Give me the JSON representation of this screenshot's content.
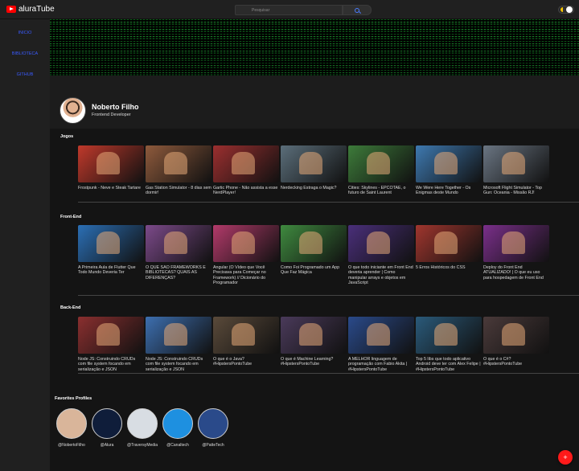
{
  "app": {
    "logo_text": "aluraTube"
  },
  "search": {
    "placeholder": "Pesquisar"
  },
  "sidebar": {
    "items": [
      {
        "label": "Inicio"
      },
      {
        "label": "Biblioteca"
      },
      {
        "label": "Github"
      }
    ]
  },
  "profile": {
    "name": "Noberto Filho",
    "role": "Frontend Developer"
  },
  "sections": [
    {
      "title": "Jogos",
      "videos": [
        {
          "title": "Frostpunk - Neve e Steak Tartare",
          "thumb_color": "#c0392b"
        },
        {
          "title": "Gas Station Simulator - 8 dias sem dormir!",
          "thumb_color": "#8e5a3c"
        },
        {
          "title": "Gartic Phone - Não assista a esse NerdPlayer!",
          "thumb_color": "#9b2f2f"
        },
        {
          "title": "Nerdecking Estraga o Magic?",
          "thumb_color": "#5b6e7a"
        },
        {
          "title": "Cities: Skylines - EPCOTAE, o futuro de Saint Laurent",
          "thumb_color": "#3d7b3a"
        },
        {
          "title": "We Were Here Together - Os Enigmas deste Mundo",
          "thumb_color": "#3e79b0"
        },
        {
          "title": "Microsoft Flight Simulator - Top Gun: Oceania - Missão RJ!",
          "thumb_color": "#6a7582"
        }
      ]
    },
    {
      "title": "Front-End",
      "videos": [
        {
          "title": "A Primeira Aula de Flutter Que Todo Mundo Deveria Ter",
          "thumb_color": "#2b6fb5"
        },
        {
          "title": "O QUE SÃO FRAMEWORKS E BIBLIOTECAS? QUAIS AS DIFERENÇAS?",
          "thumb_color": "#7c4a8a"
        },
        {
          "title": "Angular (O Vídeo que Você Precisava para Começar no Framework) // Dicionário do Programador",
          "thumb_color": "#b23a6a"
        },
        {
          "title": "Como Foi Programado um App Que Faz Mágica",
          "thumb_color": "#3f8a3f"
        },
        {
          "title": "O que todo iniciante em Front End deveria aprender | Como manipular arrays e objetos em JavaScript",
          "thumb_color": "#4a2f7a"
        },
        {
          "title": "5 Erros Históricos do CSS",
          "thumb_color": "#a0362e"
        },
        {
          "title": "Deploy do Front End ATUALIZADO! | O que eu uso para hospedagem de Front End",
          "thumb_color": "#7a2f8a"
        }
      ]
    },
    {
      "title": "Back-End",
      "videos": [
        {
          "title": "Node JS: Construindo CRUDs com file system focando em serialização e JSON",
          "thumb_color": "#8a2f2f"
        },
        {
          "title": "Node JS: Construindo CRUDs com file system focando em serialização e JSON",
          "thumb_color": "#3d6fb0"
        },
        {
          "title": "O que é o Java? #HipstersPontoTube",
          "thumb_color": "#5a4a3a"
        },
        {
          "title": "O que é Machine Learning? #HipstersPontoTube",
          "thumb_color": "#4a3a5a"
        },
        {
          "title": "A MELHOR linguagem de programação com Fabio Akita | #HipstersPontoTube",
          "thumb_color": "#2a4a8a"
        },
        {
          "title": "Top 5 libs que todo aplicativo Android deve ter com Alex Felipe | #HipstersPontoTube",
          "thumb_color": "#2a5a7a"
        },
        {
          "title": "O que é o C#? #HipstersPontoTube",
          "thumb_color": "#4a3a3a"
        }
      ]
    }
  ],
  "favorites": {
    "title": "Favorites Profiles",
    "profiles": [
      {
        "handle": "@NobertoFilho",
        "color": "#d9b59a",
        "icon": "person-photo"
      },
      {
        "handle": "@Alura",
        "color": "#0f1d3a",
        "icon": "alura-logo"
      },
      {
        "handle": "@TraversyMedia",
        "color": "#d8dde3",
        "icon": "traversy-logo"
      },
      {
        "handle": "@Canaltech",
        "color": "#1e90e0",
        "icon": "canaltech-logo"
      },
      {
        "handle": "@PatteTech",
        "color": "#2a4a8a",
        "icon": "person-photo"
      }
    ]
  },
  "fab": {
    "label": "+"
  }
}
